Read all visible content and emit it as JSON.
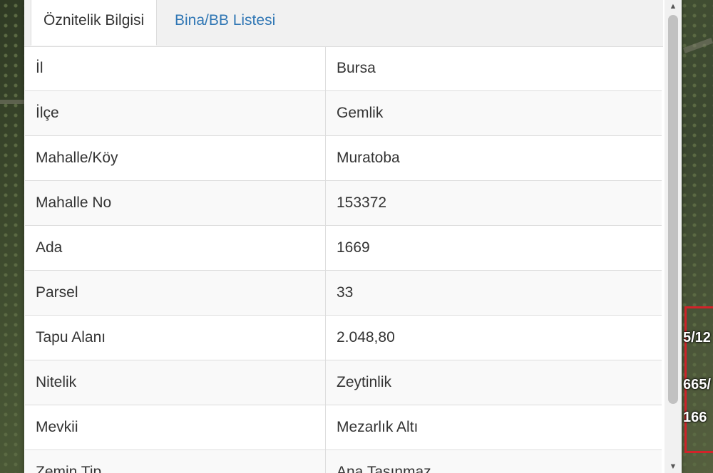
{
  "tabs": [
    {
      "label": "Öznitelik Bilgisi",
      "active": true
    },
    {
      "label": "Bina/BB Listesi",
      "active": false
    }
  ],
  "attributes": [
    {
      "key": "İl",
      "value": "Bursa"
    },
    {
      "key": "İlçe",
      "value": "Gemlik"
    },
    {
      "key": "Mahalle/Köy",
      "value": "Muratoba"
    },
    {
      "key": "Mahalle No",
      "value": "153372"
    },
    {
      "key": "Ada",
      "value": "1669"
    },
    {
      "key": "Parsel",
      "value": "33"
    },
    {
      "key": "Tapu Alanı",
      "value": "2.048,80"
    },
    {
      "key": "Nitelik",
      "value": "Zeytinlik"
    },
    {
      "key": "Mevkii",
      "value": "Mezarlık Altı"
    },
    {
      "key": "Zemin Tip",
      "value": "Ana Taşınmaz"
    }
  ],
  "map_labels": [
    "5/12",
    "665/",
    "166"
  ],
  "colors": {
    "link": "#2f76b4",
    "parcel_border": "#d2232a"
  },
  "scrollbar": {
    "up_icon": "triangle-up",
    "down_icon": "triangle-down"
  }
}
